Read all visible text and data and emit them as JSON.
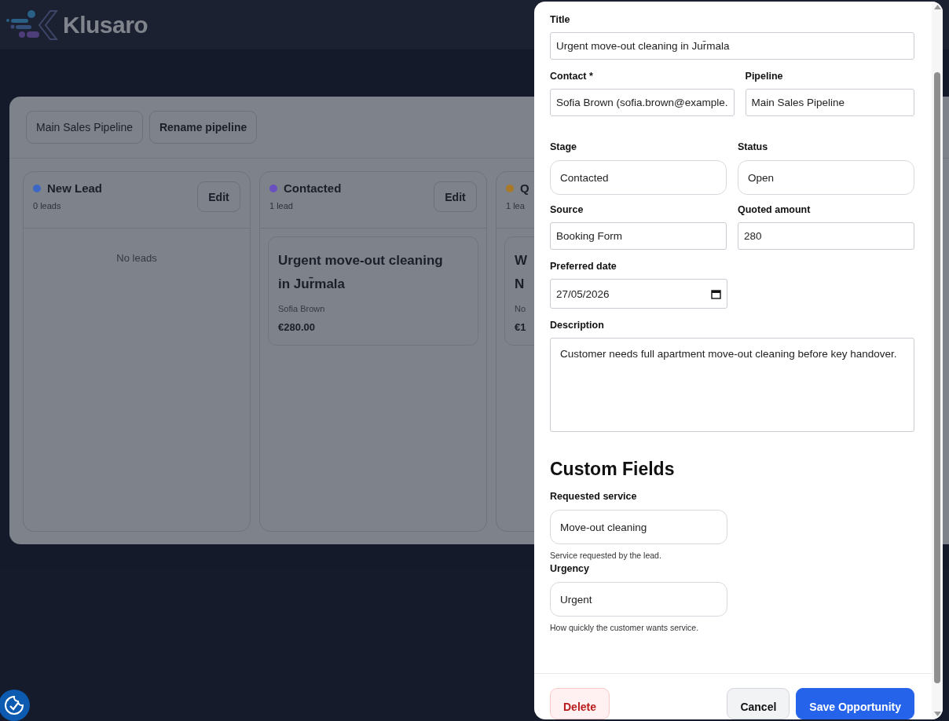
{
  "brand": {
    "name": "Klusaro"
  },
  "pipeline_bar": {
    "selector": "Main Sales Pipeline",
    "rename_button": "Rename pipeline"
  },
  "stages": [
    {
      "name": "New Lead",
      "color": "#3a68c4",
      "count": "0 leads",
      "edit_button": "Edit",
      "empty_text": "No leads"
    },
    {
      "name": "Contacted",
      "color": "#6b4fc0",
      "count": "1 lead",
      "edit_button": "Edit",
      "cards": [
        {
          "title": "Urgent move-out cleaning in Jur̄mala",
          "contact": "Sofia Brown",
          "amount": "€280.00"
        }
      ]
    },
    {
      "name": "Q",
      "color": "#a87a28",
      "count": "1 lea",
      "cards": [
        {
          "title": "W\nN",
          "contact": "No",
          "amount": "€1"
        }
      ]
    }
  ],
  "modal": {
    "rows": [
      [
        {
          "kind": "text",
          "label": "Title",
          "value": "Urgent move-out cleaning in Jur̄mala"
        }
      ],
      [
        {
          "kind": "text",
          "label": "Contact *",
          "value": "Sofia Brown (sofia.brown@example."
        },
        {
          "kind": "text",
          "label": "Pipeline",
          "value": "Main Sales Pipeline"
        }
      ],
      [
        {
          "kind": "select",
          "label": "Stage",
          "value": "Contacted"
        },
        {
          "kind": "select",
          "label": "Status",
          "value": "Open"
        }
      ],
      [
        {
          "kind": "text",
          "label": "Source",
          "value": "Booking Form"
        },
        {
          "kind": "text",
          "label": "Quoted amount",
          "value": "280"
        }
      ],
      [
        {
          "kind": "date",
          "label": "Preferred date",
          "value": "27/05/2026"
        }
      ],
      [
        {
          "kind": "textarea",
          "label": "Description",
          "value": "Customer needs full apartment move-out cleaning before key handover."
        }
      ]
    ],
    "custom_heading": "Custom Fields",
    "custom_fields": [
      {
        "kind": "select",
        "label": "Requested service",
        "value": "Move-out cleaning",
        "hint": "Service requested by the lead."
      },
      {
        "kind": "select",
        "label": "Urgency",
        "value": "Urgent",
        "hint": "How quickly the customer wants service."
      }
    ],
    "buttons": [
      {
        "kind": "danger",
        "label": "Delete"
      },
      {
        "kind": "secondary",
        "label": "Cancel"
      },
      {
        "kind": "primary",
        "label": "Save Opportunity"
      }
    ]
  }
}
